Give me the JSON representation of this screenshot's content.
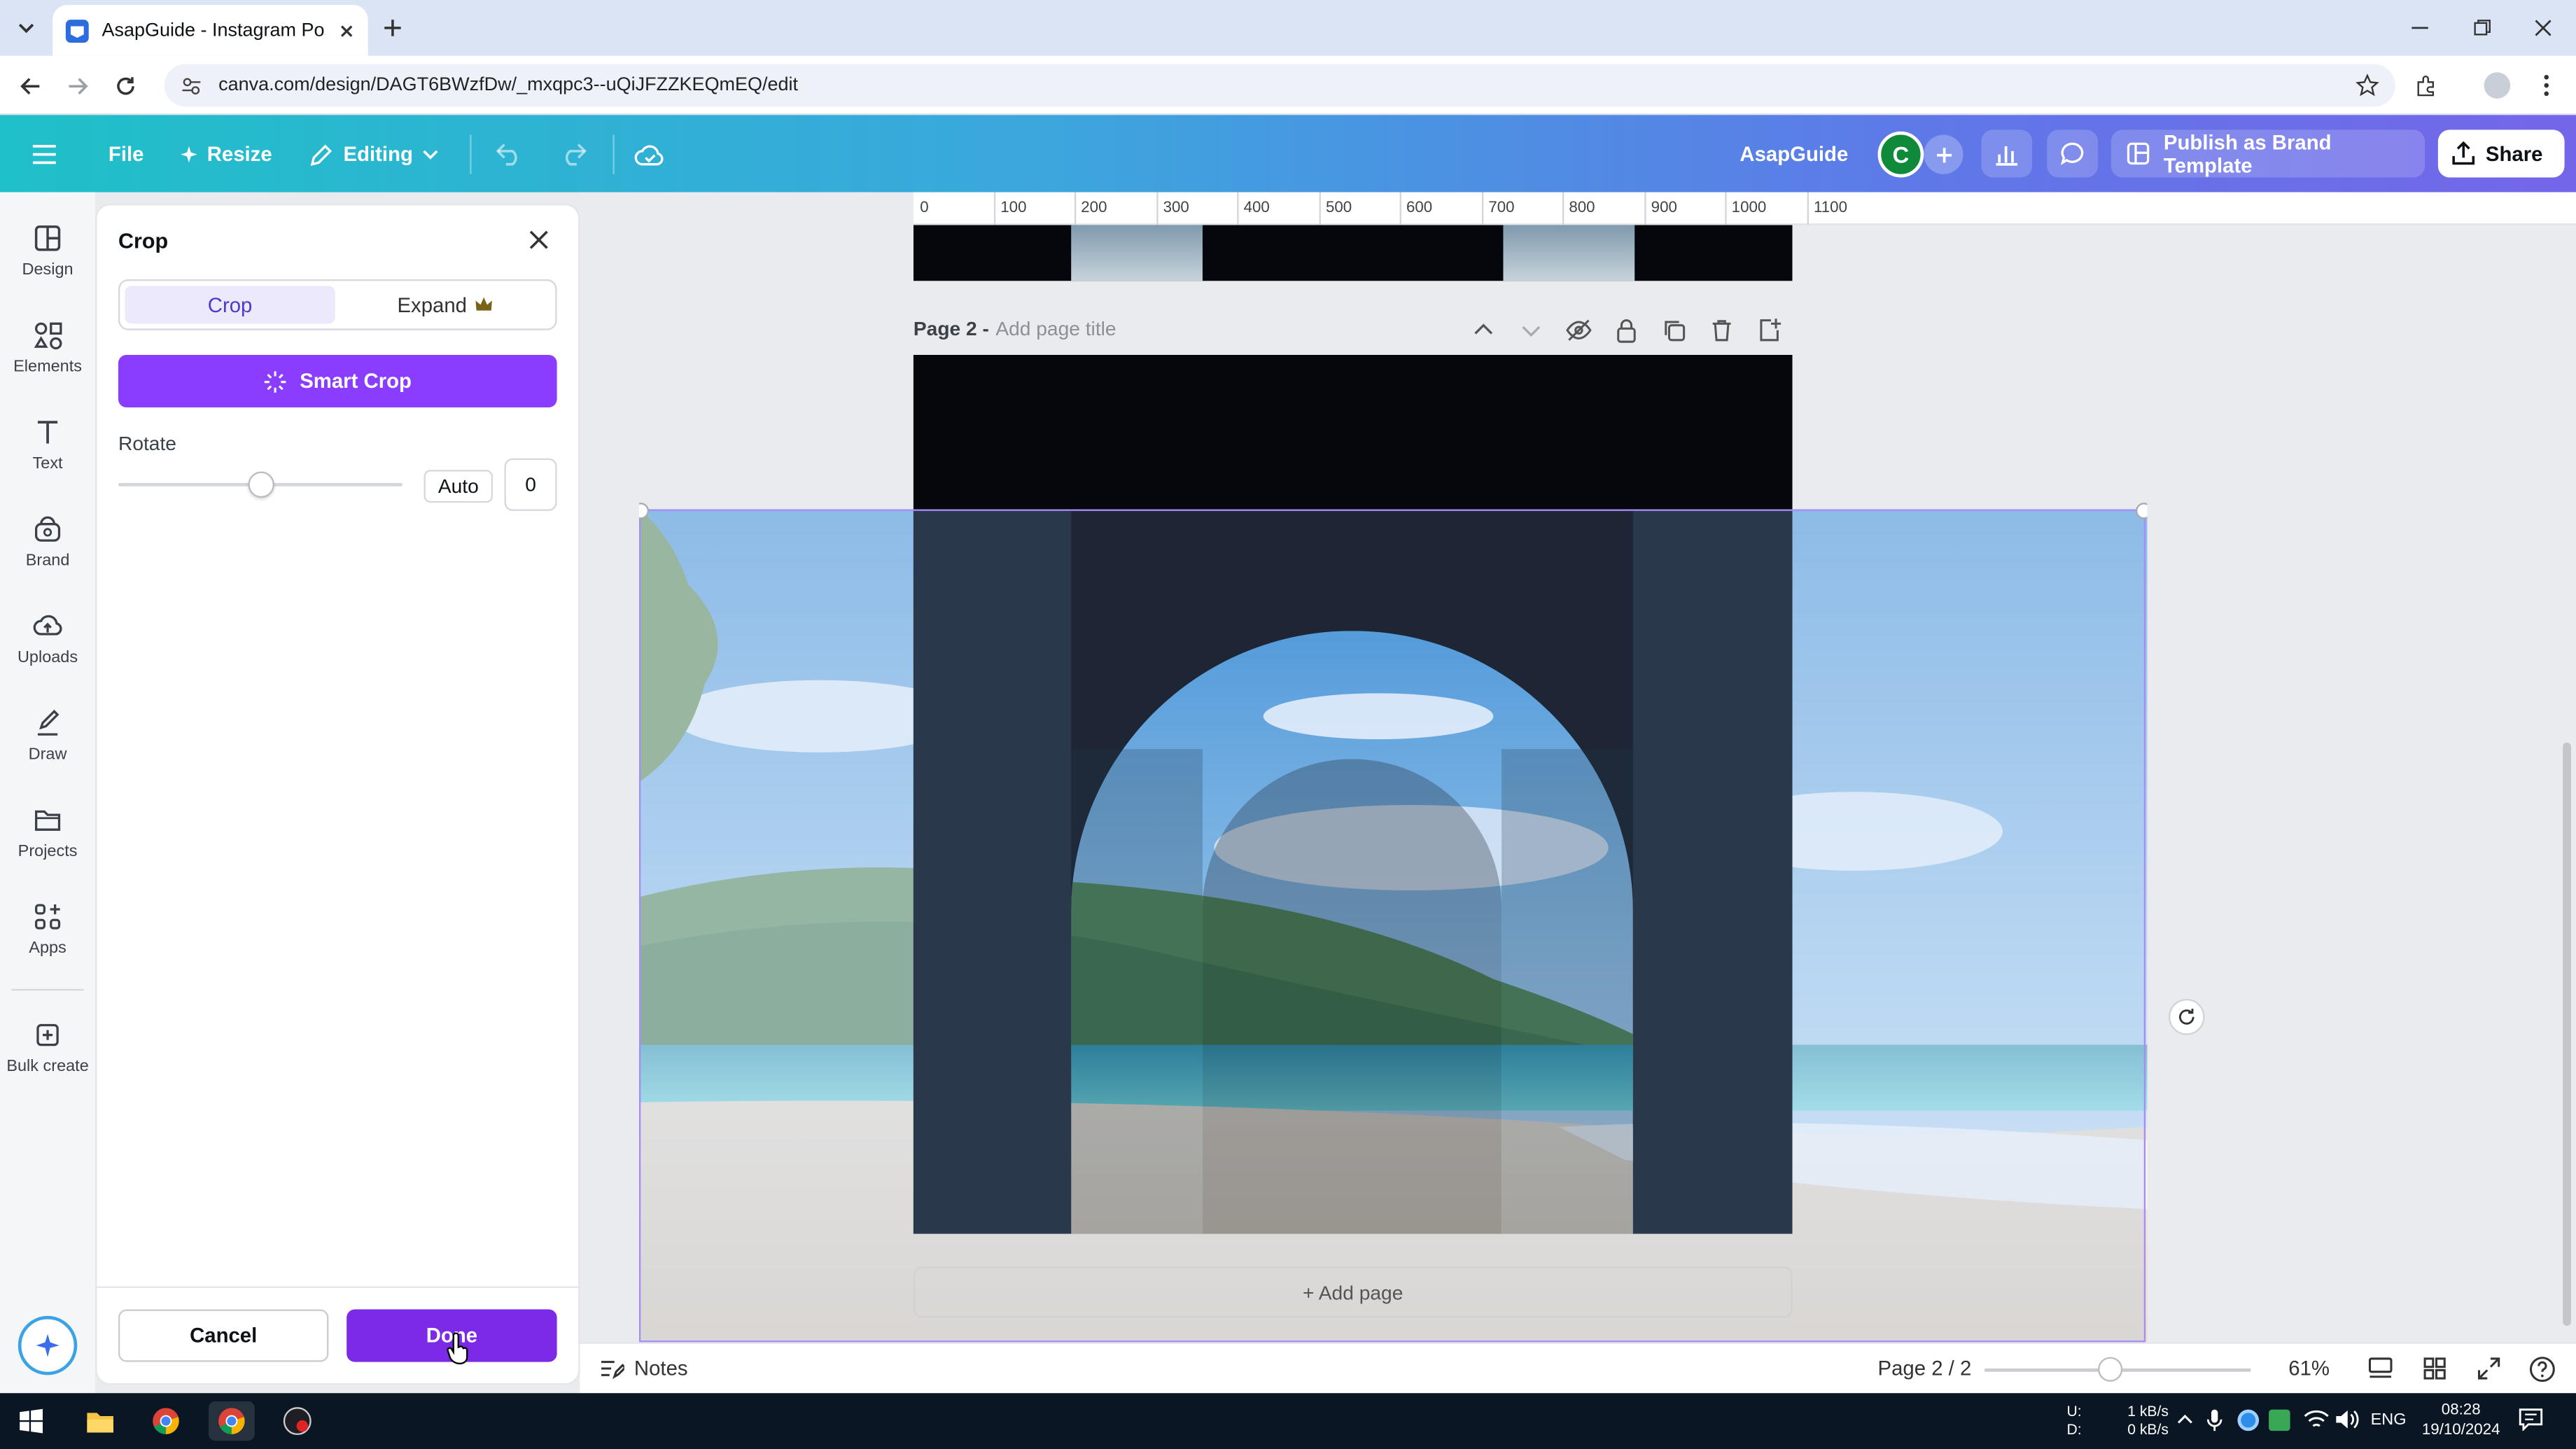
{
  "browser": {
    "tab_title": "AsapGuide - Instagram Post",
    "url": "canva.com/design/DAGT6BWzfDw/_mxqpc3--uQiJFZZKEQmEQ/edit"
  },
  "header": {
    "file": "File",
    "resize": "Resize",
    "editing": "Editing",
    "team_name": "AsapGuide",
    "avatar_letter": "C",
    "publish": "Publish as Brand Template",
    "share": "Share"
  },
  "sidebar": {
    "items": [
      {
        "label": "Design",
        "icon": "design-icon"
      },
      {
        "label": "Elements",
        "icon": "elements-icon"
      },
      {
        "label": "Text",
        "icon": "text-icon"
      },
      {
        "label": "Brand",
        "icon": "brand-icon"
      },
      {
        "label": "Uploads",
        "icon": "uploads-icon"
      },
      {
        "label": "Draw",
        "icon": "draw-icon"
      },
      {
        "label": "Projects",
        "icon": "projects-icon"
      },
      {
        "label": "Apps",
        "icon": "apps-icon"
      },
      {
        "label": "Bulk create",
        "icon": "bulk-create-icon"
      }
    ]
  },
  "crop_panel": {
    "title": "Crop",
    "tab_crop": "Crop",
    "tab_expand": "Expand",
    "smart_crop": "Smart Crop",
    "rotate_label": "Rotate",
    "auto_label": "Auto",
    "rotate_value": "0",
    "cancel": "Cancel",
    "done": "Done"
  },
  "ruler": {
    "ticks": [
      "0",
      "100",
      "200",
      "300",
      "400",
      "500",
      "600",
      "700",
      "800",
      "900",
      "1000",
      "1100"
    ]
  },
  "canvas": {
    "page_label": "Page 2 -",
    "page_title_placeholder": "Add page title",
    "add_page": "+ Add page"
  },
  "bottom_bar": {
    "notes": "Notes",
    "page_indicator": "Page 2 / 2",
    "zoom": "61%"
  },
  "taskbar": {
    "net_up_label": "U:",
    "net_down_label": "D:",
    "net_up": "1 kB/s",
    "net_down": "0 kB/s",
    "lang": "ENG",
    "time": "08:28",
    "date": "19/10/2024"
  },
  "colors": {
    "accent_purple": "#8b3dff",
    "done_purple": "#7d2ae8",
    "avatar_green": "#0f8a3a"
  }
}
